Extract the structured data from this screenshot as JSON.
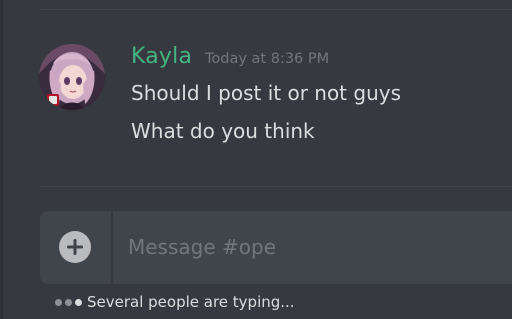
{
  "colors": {
    "background": "#36393f",
    "username": "#43b581",
    "message_text": "#dcddde",
    "timestamp": "#72767d",
    "composer_bg": "#40444b",
    "placeholder": "#72767d"
  },
  "message": {
    "author": "Kayla",
    "timestamp": "Today at 8:36 PM",
    "lines": [
      "Should I post it or not guys",
      "What do you think"
    ]
  },
  "composer": {
    "attach_icon": "plus-circle-icon",
    "placeholder": "Message #ope",
    "value": ""
  },
  "typing_indicator": {
    "text": "Several people are typing..."
  }
}
